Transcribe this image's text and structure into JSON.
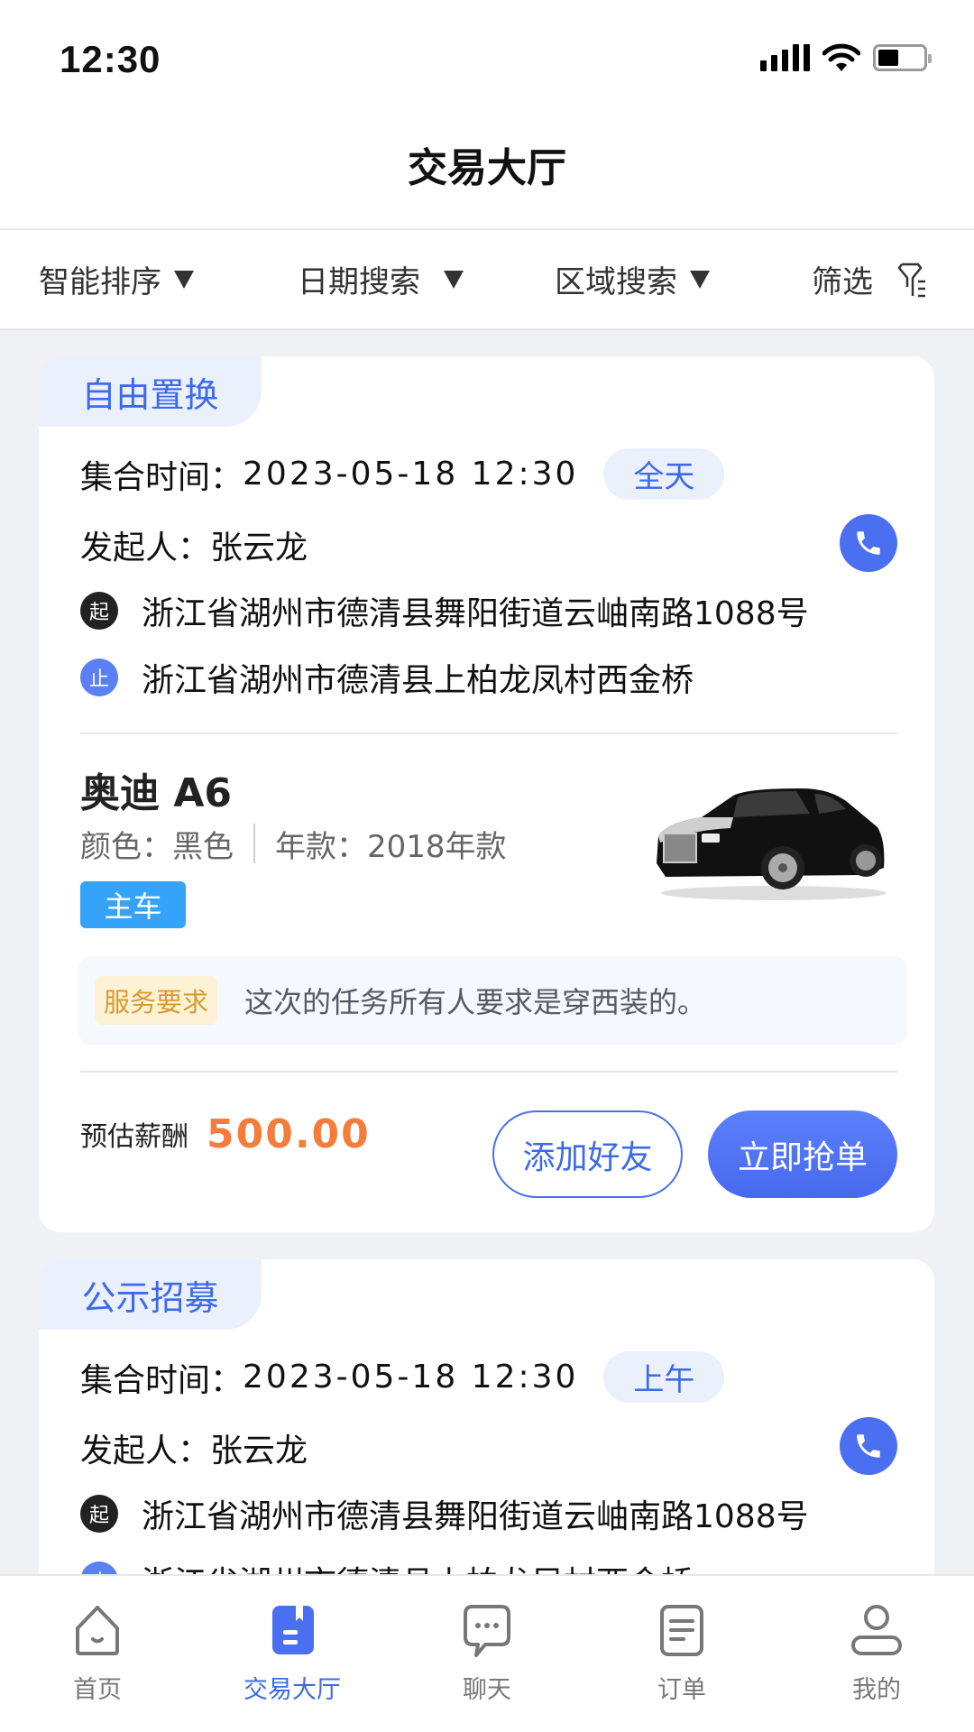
{
  "status_bar": {
    "time": "12:30",
    "battery_level": 0.45,
    "signal_bars": 4
  },
  "header": {
    "title": "交易大厅"
  },
  "filters": [
    {
      "label": "智能排序",
      "icon": "triangle-down-icon"
    },
    {
      "label": "日期搜索",
      "icon": "triangle-down-icon"
    },
    {
      "label": "区域搜索",
      "icon": "triangle-down-icon"
    },
    {
      "label": "筛选",
      "icon": "filter-funnel-icon"
    }
  ],
  "orders": [
    {
      "type_tag": "自由置换",
      "meet_time_label": "集合时间：",
      "meet_time": "2023-05-18 12:30",
      "period": "全天",
      "initiator_label": "发起人：",
      "initiator": "张云龙",
      "start_badge": "起",
      "start_address": "浙江省湖州市德清县舞阳街道云岫南路1088号",
      "end_badge": "止",
      "end_address": "浙江省湖州市德清县上柏龙凤村西金桥",
      "car_name": "奥迪 A6",
      "color_label": "颜色：",
      "color": "黑色",
      "year_label": "年款：",
      "year": "2018年款",
      "car_role": "主车",
      "requirement_tag": "服务要求",
      "requirement": "这次的任务所有人要求是穿西装的。",
      "salary_label": "预估薪酬",
      "salary": "500.00",
      "add_friend_label": "添加好友",
      "grab_label": "立即抢单"
    },
    {
      "type_tag": "公示招募",
      "meet_time_label": "集合时间：",
      "meet_time": "2023-05-18 12:30",
      "period": "上午",
      "initiator_label": "发起人：",
      "initiator": "张云龙",
      "start_badge": "起",
      "start_address": "浙江省湖州市德清县舞阳街道云岫南路1088号",
      "end_badge": "止",
      "end_address": "浙江省湖州市德清县上柏龙凤村西金桥"
    }
  ],
  "tabbar": [
    {
      "label": "首页",
      "icon": "home-icon",
      "active": false
    },
    {
      "label": "交易大厅",
      "icon": "trading-hall-icon",
      "active": true
    },
    {
      "label": "聊天",
      "icon": "chat-icon",
      "active": false
    },
    {
      "label": "订单",
      "icon": "order-icon",
      "active": false
    },
    {
      "label": "我的",
      "icon": "profile-icon",
      "active": false
    }
  ],
  "colors": {
    "primary": "#4a6ff0",
    "salary": "#f47d3b",
    "tag_bg": "#ebf0fd",
    "main_tag": "#35a3f9",
    "requirement_tag": "#d99a2e"
  }
}
